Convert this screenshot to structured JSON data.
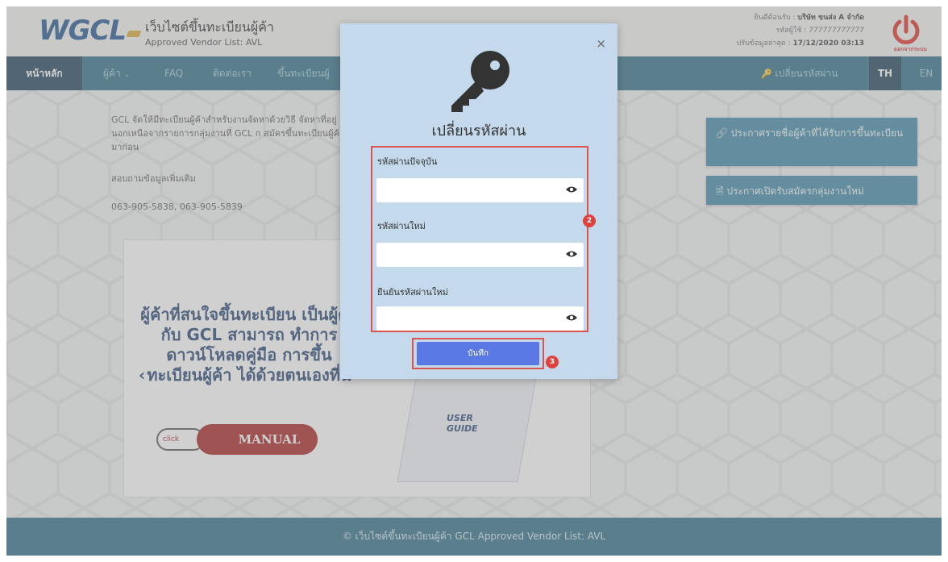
{
  "header": {
    "logo_text": "WGCL",
    "site_title": "เว็บไซต์ขึ้นทะเบียนผู้ค้า",
    "site_subtitle": "Approved Vendor List: AVL",
    "welcome_label": "ยินดีต้อนรับ :",
    "company_name": "บริษัท ขนส่ง A จำกัด",
    "user_code_label": "รหัสผู้ใช้ :",
    "user_code": "777777777777",
    "last_update_label": "ปรับข้อมูลล่าสุด :",
    "last_update": "17/12/2020 03:13",
    "logout_label": "ออกจากระบบ"
  },
  "nav": {
    "home": "หน้าหลัก",
    "vendor": "ผู้ค้า",
    "faq": "FAQ",
    "contact": "ติดต่อเรา",
    "register": "ขึ้นทะเบียนผู้",
    "change_password": "เปลี่ยนรหัสผ่าน",
    "lang_th": "TH",
    "lang_en": "EN"
  },
  "main": {
    "intro_text": "GCL จัดให้มีทะเบียนผู้ค้าสำหรับงานจัดหาด้วยวิธี จัดหาที่อยู่นอกเหนือจากรายการกลุ่มงานที่ GCL ก สมัครขึ้นทะเบียนผู้ค้ามาก่อน",
    "inquire": "สอบถามข้อมูลเพิ่มเติม",
    "phones": "063-905-5838, 063-905-5839",
    "banner_text": "ผู้ค้าที่สนใจขึ้นทะเบียน เป็นผู้ค้ากับ GCL สามารถ ทำการดาวน์โหลดคู่มือ การขึ้นทะเบียนผู้ค้า ได้ด้วยตนเองที่นี่",
    "banner_arrow": "‹",
    "click_label": "click",
    "manual_label": "MANUAL",
    "guide_label": "USER GUIDE"
  },
  "sidebar": {
    "announce_vendors": "ประกาศรายชื่อผู้ค้าที่ได้รับการขึ้นทะเบียน",
    "announce_new_group": "ประกาศเปิดรับสมัครกลุ่มงานใหม่"
  },
  "footer": {
    "text": "© เว็บไซต์ขึ้นทะเบียนผู้ค้า GCL Approved Vendor List: AVL"
  },
  "modal": {
    "title": "เปลี่ยนรหัสผ่าน",
    "close_label": "×",
    "current_password_label": "รหัสผ่านปัจจุบัน",
    "current_password_value": "",
    "new_password_label": "รหัสผ่านใหม่",
    "new_password_value": "",
    "confirm_password_label": "ยืนยันรหัสผ่านใหม่",
    "confirm_password_value": "",
    "save_label": "บันทึก",
    "badge_fields": "2",
    "badge_save": "3"
  },
  "colors": {
    "nav": "#2b6b86",
    "nav_active": "#1a3c58",
    "modal_bg": "#c4d9ec",
    "save_button": "#5a79e5",
    "highlight": "#d9534f",
    "sidebar_button": "#3b87a6"
  },
  "icons": [
    "power-icon",
    "key-icon",
    "eye-icon",
    "link-icon",
    "document-icon",
    "chevron-down-icon"
  ]
}
